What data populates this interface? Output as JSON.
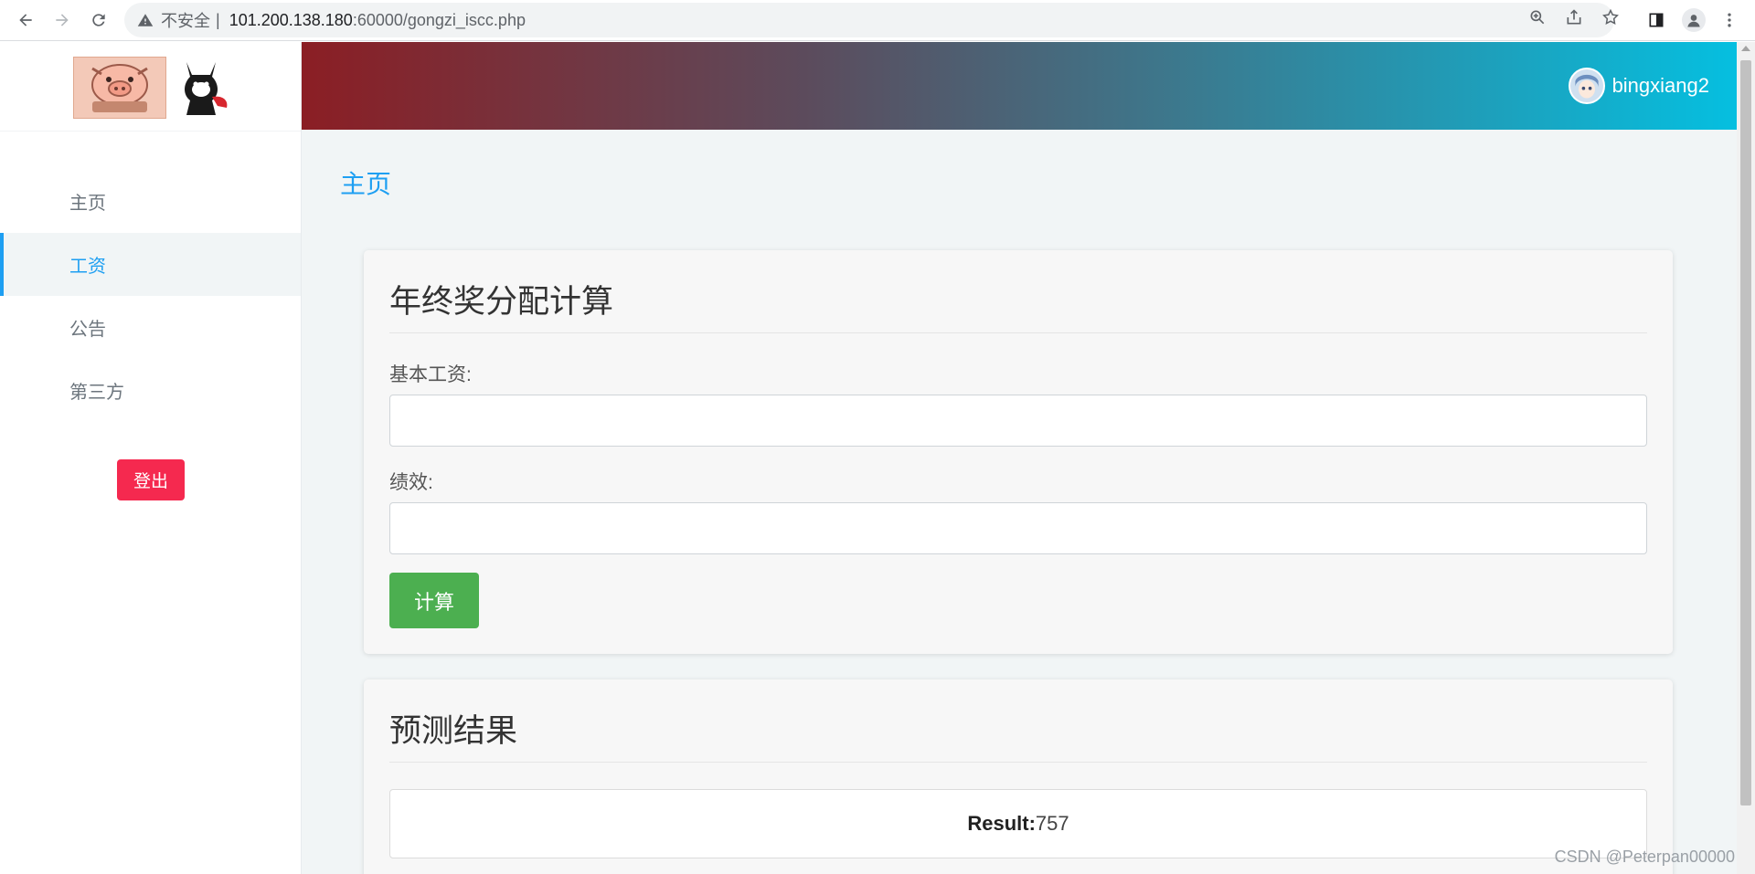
{
  "browser": {
    "security_label": "不安全",
    "separator": "|",
    "url_host": "101.200.138.180",
    "url_path": ":60000/gongzi_iscc.php"
  },
  "sidebar": {
    "items": [
      {
        "label": "主页",
        "active": false
      },
      {
        "label": "工资",
        "active": true
      },
      {
        "label": "公告",
        "active": false
      },
      {
        "label": "第三方",
        "active": false
      }
    ],
    "logout_label": "登出"
  },
  "header": {
    "username": "bingxiang2"
  },
  "main": {
    "page_title": "主页",
    "calc_card": {
      "title": "年终奖分配计算",
      "base_salary_label": "基本工资:",
      "base_salary_value": "",
      "performance_label": "绩效:",
      "performance_value": "",
      "button_label": "计算"
    },
    "result_card": {
      "title": "预测结果",
      "result_label": "Result:",
      "result_value": "757"
    }
  },
  "watermark": "CSDN @Peterpan00000",
  "colors": {
    "accent": "#1e9ff2",
    "logout": "#f5294f",
    "calc_button": "#4caf50",
    "header_gradient_start": "#8b1e24",
    "header_gradient_end": "#05bfe0"
  }
}
